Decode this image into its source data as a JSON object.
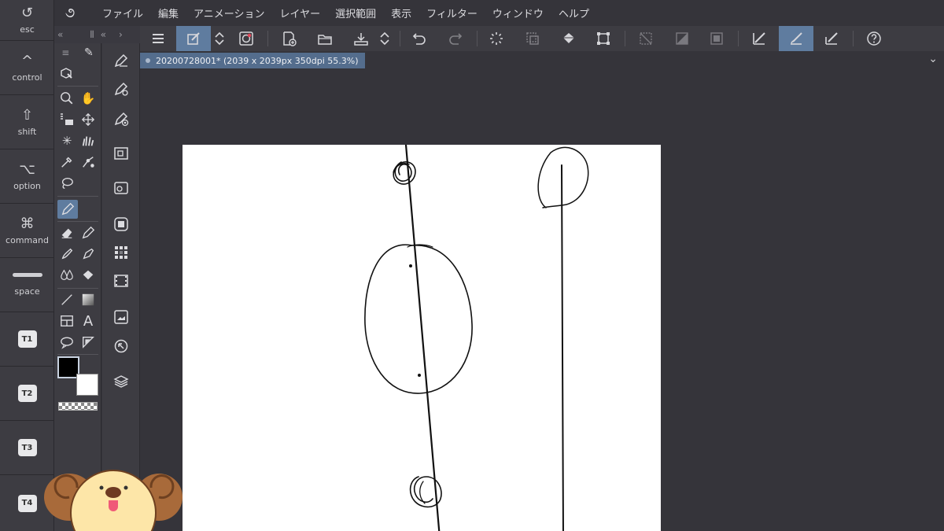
{
  "keys": [
    {
      "symbol": "↺",
      "label": "esc"
    },
    {
      "symbol": "^",
      "label": "control"
    },
    {
      "symbol": "⇧",
      "label": "shift"
    },
    {
      "symbol": "⌥",
      "label": "option"
    },
    {
      "symbol": "⌘",
      "label": "command"
    },
    {
      "symbol": "",
      "label": "space"
    }
  ],
  "tkeys": [
    "T1",
    "T2",
    "T3",
    "T4"
  ],
  "menu": {
    "logo": "૭",
    "items": [
      "ファイル",
      "編集",
      "アニメーション",
      "レイヤー",
      "選択範囲",
      "表示",
      "フィルター",
      "ウィンドウ",
      "ヘルプ"
    ]
  },
  "palette_header": {
    "collapse_left": "«",
    "grip": "⦀",
    "collapse_right": "«",
    "expand": "›"
  },
  "document": {
    "tab_title": "20200728001* (2039 x 2039px 350dpi 55.3%)",
    "chevron": "⌄"
  },
  "colors": {
    "accent": "#5f7c9f",
    "main_color": "#000000",
    "sub_color": "#ffffff",
    "canvas_bg": "#35343a"
  },
  "toolbar_icons": [
    "menu-icon",
    "edit-icon",
    "updown-icon",
    "record-icon",
    "new-icon",
    "open-icon",
    "save-icon",
    "updown-icon",
    "undo-icon",
    "redo-icon",
    "loading-icon",
    "clear-selection-icon",
    "fill-icon",
    "transform-icon",
    "snap-off-icon",
    "snap-ruler-icon",
    "snap-grid-icon",
    "ruler-icon",
    "brush-active-icon",
    "pen-ruler-icon",
    "help-icon"
  ]
}
